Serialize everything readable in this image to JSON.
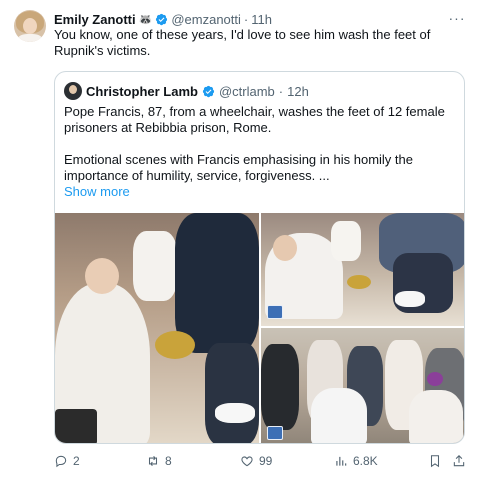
{
  "tweet": {
    "author_name": "Emily Zanotti",
    "author_emoji": "🦝",
    "handle": "@emzanotti",
    "separator": "·",
    "time": "11h",
    "more_label": "···",
    "text": "You know, one of these years, I'd love to see him wash the feet of Rupnik's victims."
  },
  "quoted": {
    "author_name": "Christopher Lamb",
    "handle": "@ctrlamb",
    "separator": "·",
    "time": "12h",
    "paragraph_1": "Pope Francis, 87, from a wheelchair, washes the feet of 12 female prisoners at Rebibbia prison, Rome.",
    "paragraph_2": "Emotional scenes with Francis emphasising in his homily the importance of humility, service, forgiveness. ...",
    "show_more": "Show more"
  },
  "actions": {
    "replies": "2",
    "reposts": "8",
    "likes": "99",
    "views": "6.8K"
  },
  "colors": {
    "accent": "#1d9bf0",
    "secondary_text": "#536471",
    "border": "#cfd9de"
  }
}
